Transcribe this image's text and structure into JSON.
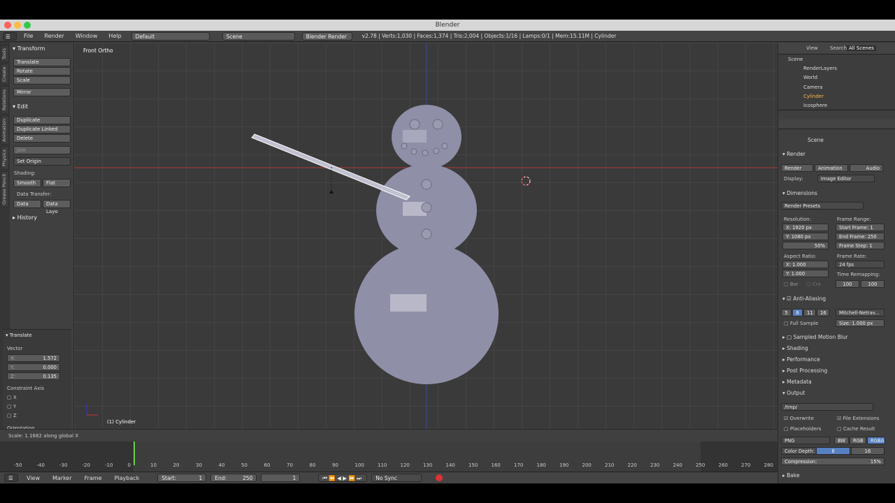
{
  "window": {
    "title": "Blender"
  },
  "menubar": {
    "menus": [
      "File",
      "Render",
      "Window",
      "Help"
    ],
    "layout": "Default",
    "scene": "Scene",
    "engine": "Blender Render",
    "info": "v2.78 | Verts:1,030 | Faces:1,374 | Tris:2,004 | Objects:1/16 | Lamps:0/1 | Mem:15.11M | Cylinder"
  },
  "toolshelf": {
    "tabs": [
      "Tools",
      "Create",
      "Relations",
      "Animation",
      "Physics",
      "Grease Pencil"
    ],
    "transform_title": "Transform",
    "transform_buttons": [
      "Translate",
      "Rotate",
      "Scale",
      "Mirror"
    ],
    "edit_title": "Edit",
    "edit_buttons": [
      "Duplicate",
      "Duplicate Linked",
      "Delete"
    ],
    "join": "Join",
    "set_origin": "Set Origin",
    "shading_label": "Shading:",
    "smooth": "Smooth",
    "flat": "Flat",
    "data_transfer_label": "Data Transfer:",
    "data": "Data",
    "data_layo": "Data Layo",
    "history": "History"
  },
  "operator": {
    "title": "Translate",
    "vector_label": "Vector",
    "x": "1.572",
    "y": "0.000",
    "z": "0.135",
    "constraint_label": "Constraint Axis",
    "axes": [
      "X",
      "Y",
      "Z"
    ],
    "orientation": "Orientation"
  },
  "viewport": {
    "view_name": "Front Ortho",
    "object_label": "(1) Cylinder"
  },
  "status": {
    "text": "Scale: 1.1682 along global X"
  },
  "outliner": {
    "tabs": [
      "View",
      "Search",
      "All Scenes"
    ],
    "items": [
      "Scene",
      "RenderLayers",
      "World",
      "Camera",
      "Cylinder",
      "Icosphere"
    ]
  },
  "properties": {
    "scene": "Scene",
    "render_title": "Render",
    "render_tabs": [
      "Render",
      "Animation",
      "Audio"
    ],
    "display_label": "Display:",
    "display_value": "Image Editor",
    "dimensions_title": "Dimensions",
    "render_presets": "Render Presets",
    "resolution_label": "Resolution:",
    "res_x": "X:    1920 px",
    "res_y": "Y:    1080 px",
    "res_pct": "50%",
    "frame_range_label": "Frame Range:",
    "start_frame": "Start Frame: 1",
    "end_frame": "End Frame: 250",
    "frame_step": "Frame Step: 1",
    "aspect_label": "Aspect Ratio:",
    "asp_x": "X:     1.000",
    "asp_y": "Y:     1.000",
    "frame_rate_label": "Frame Rate:",
    "fps": "24 fps",
    "time_remap_label": "Time Remapping:",
    "remap_old": "100",
    "remap_new": "100",
    "bor": "Bor",
    "cro": "Cro",
    "aa_title": "Anti-Aliasing",
    "aa_samples": [
      "5",
      "8",
      "11",
      "16"
    ],
    "aa_filter": "Mitchell-Netrav...",
    "full_sample": "Full Sample",
    "aa_size": "Size: 1.000 px",
    "sections": [
      "Sampled Motion Blur",
      "Shading",
      "Performance",
      "Post Processing",
      "Metadata"
    ],
    "output_title": "Output",
    "output_path": "/tmp/",
    "overwrite": "Overwrite",
    "file_ext": "File Extensions",
    "placeholders": "Placeholders",
    "cache": "Cache Result",
    "format": "PNG",
    "color_modes": [
      "BW",
      "RGB",
      "RGBA"
    ],
    "color_depth_label": "Color Depth:",
    "depth_8": "8",
    "depth_16": "16",
    "compression": "Compression:",
    "compression_val": "15%",
    "bake": "Bake"
  },
  "timeline": {
    "ticks": [
      "-50",
      "-40",
      "-30",
      "-20",
      "-10",
      "0",
      "10",
      "20",
      "30",
      "40",
      "50",
      "60",
      "70",
      "80",
      "90",
      "100",
      "110",
      "120",
      "130",
      "140",
      "150",
      "160",
      "170",
      "180",
      "190",
      "200",
      "210",
      "220",
      "230",
      "240",
      "250",
      "260",
      "270",
      "280"
    ],
    "menus": [
      "View",
      "Marker",
      "Frame",
      "Playback"
    ],
    "start": "Start:",
    "start_val": "1",
    "end": "End:",
    "end_val": "250",
    "current": "1",
    "sync": "No Sync"
  }
}
